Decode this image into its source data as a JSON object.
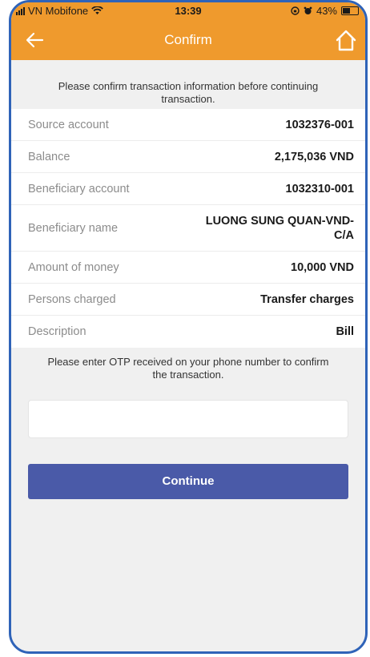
{
  "status_bar": {
    "carrier": "VN Mobifone",
    "time": "13:39",
    "battery": "43%"
  },
  "header": {
    "title": "Confirm",
    "back_icon": "arrow-left-icon",
    "home_icon": "home-icon"
  },
  "notice": "Please confirm transaction information before continuing transaction.",
  "details": [
    {
      "label": "Source account",
      "value": "1032376-001"
    },
    {
      "label": "Balance",
      "value": "2,175,036 VND"
    },
    {
      "label": "Beneficiary account",
      "value": "1032310-001"
    },
    {
      "label": "Beneficiary name",
      "value": "LUONG SUNG QUAN-VND-C/A"
    },
    {
      "label": "Amount of money",
      "value": "10,000 VND"
    },
    {
      "label": "Persons charged",
      "value": "Transfer charges"
    },
    {
      "label": "Description",
      "value": "Bill"
    }
  ],
  "otp": {
    "prompt": "Please enter OTP received on your phone number to confirm the transaction.",
    "value": ""
  },
  "continue_label": "Continue",
  "colors": {
    "header": "#ef9a2d",
    "button": "#4a5aa8",
    "frame_border": "#2f63b8"
  }
}
